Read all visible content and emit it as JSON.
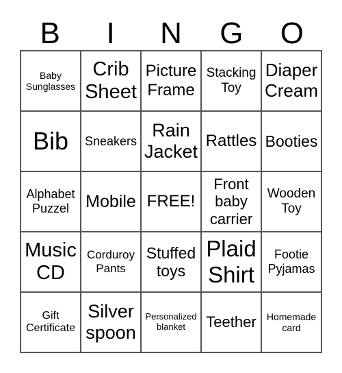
{
  "header": [
    "B",
    "I",
    "N",
    "G",
    "O"
  ],
  "cells": [
    [
      "Baby Sunglasses",
      "Crib Sheet",
      "Picture Frame",
      "Stacking Toy",
      "Diaper Cream"
    ],
    [
      "Bib",
      "Sneakers",
      "Rain Jacket",
      "Rattles",
      "Booties"
    ],
    [
      "Alphabet Puzzel",
      "Mobile",
      "FREE!",
      "Front baby carrier",
      "Wooden Toy"
    ],
    [
      "Music CD",
      "Corduroy Pants",
      "Stuffed toys",
      "Plaid Shirt",
      "Footie Pyjamas"
    ],
    [
      "Gift Certificate",
      "Silver spoon",
      "Personalized blanket",
      "Teether",
      "Homemade card"
    ]
  ]
}
